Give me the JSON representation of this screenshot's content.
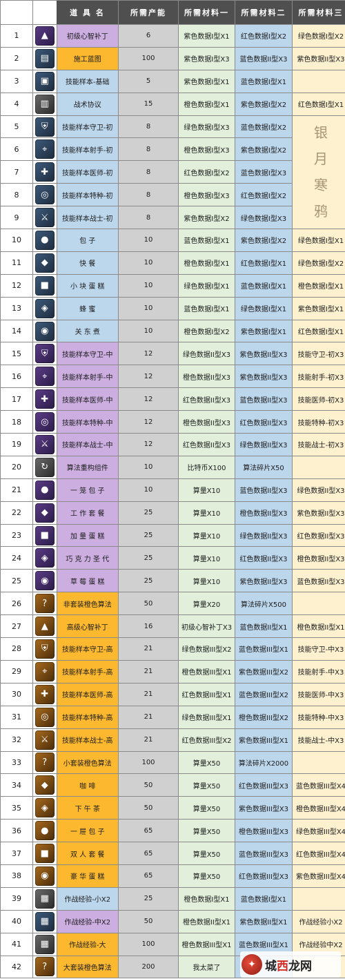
{
  "headers": {
    "idx": "序 号",
    "name": "道 具 名",
    "prod": "所需产能",
    "m1": "所需材料一",
    "m2": "所需材料二",
    "m3": "所需材料三"
  },
  "watermark_text": [
    "银",
    "月",
    "寒",
    "鸦"
  ],
  "brand": {
    "part1": "城",
    "part2": "西",
    "part3": "龙网",
    "logo": "✦"
  },
  "colors": {
    "purple": "#ccaee1",
    "blue": "#bcd6ec",
    "orange": "#fcb82e",
    "header": "#4f4f4f"
  },
  "rows": [
    {
      "idx": "1",
      "icon": "purple-gem-icon",
      "ic": "purple",
      "glyph": "▲",
      "name": "初级心智补丁",
      "nc": "purple",
      "prod": "6",
      "m1": "紫色数据I型X1",
      "m2": "红色数据I型X2",
      "m3": "绿色数据I型X2"
    },
    {
      "idx": "2",
      "icon": "blueprint-icon",
      "ic": "blue",
      "glyph": "▤",
      "name": "施工蓝图",
      "nc": "orange",
      "prod": "100",
      "m1": "紫色数据I型X3",
      "m2": "蓝色数据II型X3",
      "m3": "紫色数据II型X3"
    },
    {
      "idx": "3",
      "icon": "skill-sample-icon",
      "ic": "blue",
      "glyph": "▣",
      "name": "技能样本-基础",
      "nc": "blue",
      "prod": "5",
      "m1": "紫色数据I型X1",
      "m2": "蓝色数据I型X1",
      "m3": ""
    },
    {
      "idx": "4",
      "icon": "tactical-protocol-icon",
      "ic": "gray",
      "glyph": "▥",
      "name": "战术协议",
      "nc": "blue",
      "prod": "15",
      "m1": "橙色数据I型X1",
      "m2": "紫色数据I型X2",
      "m3": "红色数据I型X1"
    },
    {
      "idx": "5",
      "icon": "guard-sample-icon",
      "ic": "blue",
      "glyph": "⛨",
      "name": "技能样本守卫-初",
      "nc": "blue",
      "prod": "8",
      "m1": "绿色数据I型X3",
      "m2": "蓝色数据I型X2",
      "m3": ""
    },
    {
      "idx": "6",
      "icon": "sniper-sample-icon",
      "ic": "blue",
      "glyph": "⌖",
      "name": "技能样本射手-初",
      "nc": "blue",
      "prod": "8",
      "m1": "橙色数据I型X3",
      "m2": "紫色数据I型X2",
      "m3": ""
    },
    {
      "idx": "7",
      "icon": "medic-sample-icon",
      "ic": "blue",
      "glyph": "✚",
      "name": "技能样本医师-初",
      "nc": "blue",
      "prod": "8",
      "m1": "红色数据I型X2",
      "m2": "蓝色数据I型X3",
      "m3": ""
    },
    {
      "idx": "8",
      "icon": "special-sample-icon",
      "ic": "blue",
      "glyph": "◎",
      "name": "技能样本特种-初",
      "nc": "blue",
      "prod": "8",
      "m1": "橙色数据I型X3",
      "m2": "红色数据I型X2",
      "m3": ""
    },
    {
      "idx": "9",
      "icon": "warrior-sample-icon",
      "ic": "blue",
      "glyph": "⚔",
      "name": "技能样本战士-初",
      "nc": "blue",
      "prod": "8",
      "m1": "紫色数据I型X2",
      "m2": "绿色数据I型X3",
      "m3": ""
    },
    {
      "idx": "10",
      "icon": "bun-icon",
      "ic": "blue",
      "glyph": "●",
      "name": "包 子",
      "nc": "blue",
      "prod": "10",
      "m1": "蓝色数据I型X1",
      "m2": "紫色数据I型X2",
      "m3": "绿色数据I型X1"
    },
    {
      "idx": "11",
      "icon": "fast-food-icon",
      "ic": "blue",
      "glyph": "◆",
      "name": "快 餐",
      "nc": "blue",
      "prod": "10",
      "m1": "橙色数据I型X1",
      "m2": "红色数据I型X1",
      "m3": "绿色数据I型X2"
    },
    {
      "idx": "12",
      "icon": "cake-icon",
      "ic": "blue",
      "glyph": "■",
      "name": "小 块 蛋 糕",
      "nc": "blue",
      "prod": "10",
      "m1": "绿色数据I型X1",
      "m2": "蓝色数据I型X1",
      "m3": "橙色数据I型X1"
    },
    {
      "idx": "13",
      "icon": "honey-icon",
      "ic": "blue",
      "glyph": "◈",
      "name": "蜂 蜜",
      "nc": "blue",
      "prod": "10",
      "m1": "蓝色数据I型X1",
      "m2": "绿色数据I型X1",
      "m3": "紫色数据I型X1"
    },
    {
      "idx": "14",
      "icon": "oden-icon",
      "ic": "blue",
      "glyph": "◉",
      "name": "关 东 煮",
      "nc": "blue",
      "prod": "10",
      "m1": "橙色数据I型X2",
      "m2": "紫色数据I型X1",
      "m3": "红色数据I型X1"
    },
    {
      "idx": "15",
      "icon": "guard-sample-mid-icon",
      "ic": "purple",
      "glyph": "⛨",
      "name": "技能样本守卫-中",
      "nc": "purple",
      "prod": "12",
      "m1": "绿色数据II型X3",
      "m2": "紫色数据II型X3",
      "m3": "技能守卫-初X3"
    },
    {
      "idx": "16",
      "icon": "sniper-sample-mid-icon",
      "ic": "purple",
      "glyph": "⌖",
      "name": "技能样本射手-中",
      "nc": "purple",
      "prod": "12",
      "m1": "橙色数据II型X3",
      "m2": "紫色数据II型X3",
      "m3": "技能射手-初X3"
    },
    {
      "idx": "17",
      "icon": "medic-sample-mid-icon",
      "ic": "purple",
      "glyph": "✚",
      "name": "技能样本医师-中",
      "nc": "purple",
      "prod": "12",
      "m1": "红色数据II型X3",
      "m2": "蓝色数据II型X3",
      "m3": "技能医师-初X3"
    },
    {
      "idx": "18",
      "icon": "special-sample-mid-icon",
      "ic": "purple",
      "glyph": "◎",
      "name": "技能样本特种-中",
      "nc": "purple",
      "prod": "12",
      "m1": "橙色数据II型X3",
      "m2": "红色数据II型X3",
      "m3": "技能特种-初X3"
    },
    {
      "idx": "19",
      "icon": "warrior-sample-mid-icon",
      "ic": "purple",
      "glyph": "⚔",
      "name": "技能样本战士-中",
      "nc": "purple",
      "prod": "12",
      "m1": "红色数据II型X3",
      "m2": "绿色数据II型X3",
      "m3": "技能战士-初X3"
    },
    {
      "idx": "20",
      "icon": "algorithm-component-icon",
      "ic": "gray",
      "glyph": "↻",
      "name": "算法重构组件",
      "nc": "purple",
      "prod": "10",
      "m1": "比特币X100",
      "m2": "算法碎片X50",
      "m3": ""
    },
    {
      "idx": "21",
      "icon": "steamer-bun-icon",
      "ic": "purple",
      "glyph": "●",
      "name": "一 笼 包 子",
      "nc": "purple",
      "prod": "10",
      "m1": "算量X10",
      "m2": "蓝色数据II型X3",
      "m3": "绿色数据II型X3"
    },
    {
      "idx": "22",
      "icon": "work-meal-icon",
      "ic": "purple",
      "glyph": "◆",
      "name": "工 作 套 餐",
      "nc": "purple",
      "prod": "25",
      "m1": "算量X10",
      "m2": "橙色数据II型X3",
      "m3": "紫色数据II型X3"
    },
    {
      "idx": "23",
      "icon": "big-cake-icon",
      "ic": "purple",
      "glyph": "■",
      "name": "加 量 蛋 糕",
      "nc": "purple",
      "prod": "25",
      "m1": "算量X10",
      "m2": "绿色数据II型X3",
      "m3": "红色数据II型X3"
    },
    {
      "idx": "24",
      "icon": "sundae-icon",
      "ic": "purple",
      "glyph": "◈",
      "name": "巧 克 力 圣 代",
      "nc": "purple",
      "prod": "25",
      "m1": "算量X10",
      "m2": "红色数据II型X3",
      "m3": "橙色数据II型X3"
    },
    {
      "idx": "25",
      "icon": "strawberry-cake-icon",
      "ic": "purple",
      "glyph": "◉",
      "name": "草 莓 蛋 糕",
      "nc": "purple",
      "prod": "25",
      "m1": "算量X10",
      "m2": "紫色数据II型X3",
      "m3": "蓝色数据II型X3"
    },
    {
      "idx": "26",
      "icon": "orange-algorithm-icon",
      "ic": "orange",
      "glyph": "?",
      "name": "非套装橙色算法",
      "nc": "orange",
      "prod": "50",
      "m1": "算量X20",
      "m2": "算法碎片X500",
      "m3": ""
    },
    {
      "idx": "27",
      "icon": "orange-gem-icon",
      "ic": "orange",
      "glyph": "▲",
      "name": "高级心智补丁",
      "nc": "orange",
      "prod": "16",
      "m1": "初级心智补丁X3",
      "m2": "蓝色数据II型X1",
      "m3": "橙色数据II型X1"
    },
    {
      "idx": "28",
      "icon": "guard-sample-high-icon",
      "ic": "orange",
      "glyph": "⛨",
      "name": "技能样本守卫-高",
      "nc": "orange",
      "prod": "21",
      "m1": "绿色数据III型X2",
      "m2": "蓝色数据III型X1",
      "m3": "技能守卫-中X3"
    },
    {
      "idx": "29",
      "icon": "sniper-sample-high-icon",
      "ic": "orange",
      "glyph": "⌖",
      "name": "技能样本射手-高",
      "nc": "orange",
      "prod": "21",
      "m1": "橙色数据III型X1",
      "m2": "紫色数据III型X2",
      "m3": "技能射手-中X3"
    },
    {
      "idx": "30",
      "icon": "medic-sample-high-icon",
      "ic": "orange",
      "glyph": "✚",
      "name": "技能样本医师-高",
      "nc": "orange",
      "prod": "21",
      "m1": "红色数据III型X1",
      "m2": "蓝色数据III型X2",
      "m3": "技能医师-中X3"
    },
    {
      "idx": "31",
      "icon": "special-sample-high-icon",
      "ic": "orange",
      "glyph": "◎",
      "name": "技能样本特种-高",
      "nc": "orange",
      "prod": "21",
      "m1": "绿色数据III型X1",
      "m2": "橙色数据III型X2",
      "m3": "技能特种-中X3"
    },
    {
      "idx": "32",
      "icon": "warrior-sample-high-icon",
      "ic": "orange",
      "glyph": "⚔",
      "name": "技能样本战士-高",
      "nc": "orange",
      "prod": "21",
      "m1": "红色数据III型X2",
      "m2": "紫色数据III型X1",
      "m3": "技能战士-中X3"
    },
    {
      "idx": "33",
      "icon": "small-set-algorithm-icon",
      "ic": "orange",
      "glyph": "?",
      "name": "小套装橙色算法",
      "nc": "orange",
      "prod": "100",
      "m1": "算量X50",
      "m2": "算法碎片X2000",
      "m3": ""
    },
    {
      "idx": "34",
      "icon": "coffee-icon",
      "ic": "orange",
      "glyph": "◆",
      "name": "咖 啡",
      "nc": "orange",
      "prod": "50",
      "m1": "算量X50",
      "m2": "红色数据III型X3",
      "m3": "蓝色数据III型X4"
    },
    {
      "idx": "35",
      "icon": "afternoon-tea-icon",
      "ic": "orange",
      "glyph": "◈",
      "name": "下 午 茶",
      "nc": "orange",
      "prod": "50",
      "m1": "算量X50",
      "m2": "紫色数据III型X3",
      "m3": "橙色数据III型X4"
    },
    {
      "idx": "36",
      "icon": "drawer-bun-icon",
      "ic": "orange",
      "glyph": "●",
      "name": "一 屉 包 子",
      "nc": "orange",
      "prod": "65",
      "m1": "算量X50",
      "m2": "橙色数据III型X3",
      "m3": "绿色数据III型X4"
    },
    {
      "idx": "37",
      "icon": "double-meal-icon",
      "ic": "orange",
      "glyph": "■",
      "name": "双 人 套 餐",
      "nc": "orange",
      "prod": "65",
      "m1": "算量X50",
      "m2": "蓝色数据III型X3",
      "m3": "红色数据III型X4"
    },
    {
      "idx": "38",
      "icon": "deluxe-cake-icon",
      "ic": "orange",
      "glyph": "◉",
      "name": "豪 华 蛋 糕",
      "nc": "orange",
      "prod": "65",
      "m1": "算量X50",
      "m2": "红色数据III型X3",
      "m3": "紫色数据III型X4"
    },
    {
      "idx": "39",
      "icon": "exp-small-icon",
      "ic": "gray",
      "glyph": "▦",
      "name": "作战经验-小X2",
      "nc": "blue",
      "prod": "25",
      "m1": "橙色数据I型X1",
      "m2": "蓝色数据I型X1",
      "m3": ""
    },
    {
      "idx": "40",
      "icon": "exp-mid-icon",
      "ic": "blue",
      "glyph": "▦",
      "name": "作战经验-中X2",
      "nc": "purple",
      "prod": "50",
      "m1": "橙色数据II型X1",
      "m2": "紫色数据II型X1",
      "m3": "作战经验小X2"
    },
    {
      "idx": "41",
      "icon": "exp-large-icon",
      "ic": "gray",
      "glyph": "▦",
      "name": "作战经验-大",
      "nc": "orange",
      "prod": "100",
      "m1": "橙色数据III型X1",
      "m2": "蓝色数据III型X1",
      "m3": "作战经验中X2"
    },
    {
      "idx": "42",
      "icon": "big-set-algorithm-icon",
      "ic": "orange",
      "glyph": "?",
      "name": "大套装橙色算法",
      "nc": "orange",
      "prod": "200",
      "m1": "我太菜了",
      "m2": "",
      "m3": ""
    }
  ]
}
